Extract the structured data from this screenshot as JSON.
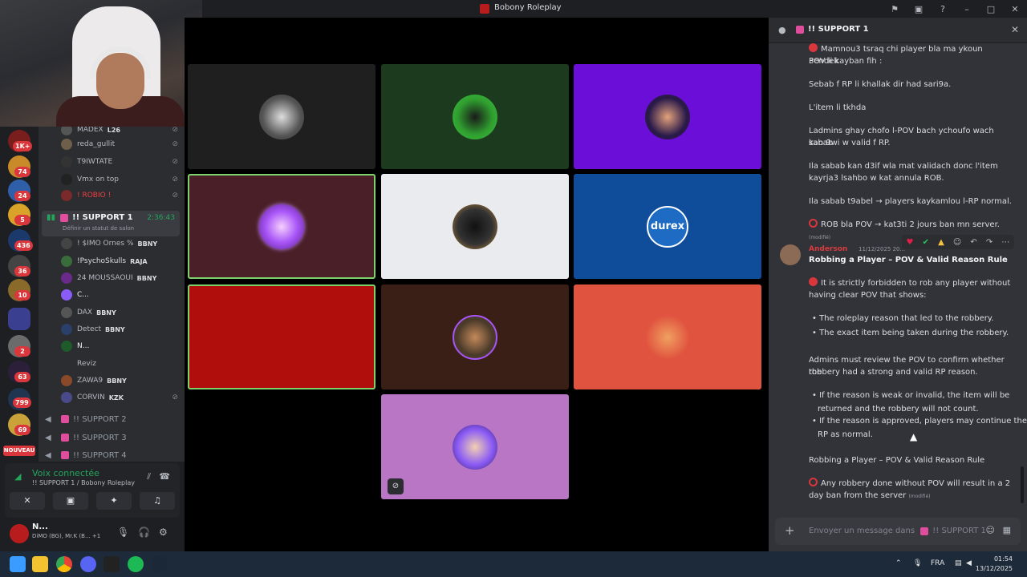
{
  "window": {
    "title": "Bobony Roleplay"
  },
  "rail": {
    "badges": [
      "1K+",
      "74",
      "24",
      "5",
      "436",
      "36",
      "10",
      "2",
      "63",
      "799",
      "69"
    ],
    "nouveau_label": "NOUVEAU"
  },
  "sidebar": {
    "members_top": [
      {
        "name": "MADEX",
        "tag": "L26"
      },
      {
        "name": "reda_gullit",
        "tag": ""
      },
      {
        "name": "T9IWTATE",
        "tag": ""
      },
      {
        "name": "Vmx on top",
        "tag": ""
      },
      {
        "name": "! ROBIO !",
        "tag": ""
      }
    ],
    "support1": {
      "label": "!! SUPPORT 1",
      "time": "2:36:43",
      "status": "Définir un statut de salon"
    },
    "members": [
      {
        "name": "! $IMO Ornes %",
        "tag": "BBNY"
      },
      {
        "name": "!PsychoSkulls",
        "tag": "RAJA"
      },
      {
        "name": "24 MOUSSAOUI",
        "tag": "BBNY"
      },
      {
        "name": "C...",
        "tag": ""
      },
      {
        "name": "DAX",
        "tag": "BBNY"
      },
      {
        "name": "Detect",
        "tag": "BBNY"
      },
      {
        "name": "N...",
        "tag": ""
      },
      {
        "name": "Reviz",
        "tag": ""
      },
      {
        "name": "ZAWA9",
        "tag": "BBNY"
      },
      {
        "name": "CORVIN",
        "tag": "KZK"
      }
    ],
    "channels": [
      "!! SUPPORT 2",
      "!! SUPPORT 3",
      "!! SUPPORT 4"
    ]
  },
  "voice": {
    "title": "Voix connectée",
    "subtitle": "!! SUPPORT 1 / Bobony Roleplay"
  },
  "user": {
    "name": "N...",
    "status": "DiMO (BG), Mr.K (B...  +1"
  },
  "stage": {
    "tiles": [
      {
        "bg": "#1f1f1f",
        "avatar": "#444444",
        "speaking": false
      },
      {
        "bg": "#1b3a1e",
        "avatar": "#3fbf3f",
        "speaking": false
      },
      {
        "bg": "#6a0ed8",
        "avatar": "#2a1a4a",
        "speaking": false
      },
      {
        "bg": "#4a1f27",
        "avatar": "#a855f7",
        "speaking": true
      },
      {
        "bg": "#e9ebee",
        "avatar": "#222222",
        "speaking": false
      },
      {
        "bg": "#0f4c9a",
        "avatar": "#1e6bc4",
        "speaking": false
      },
      {
        "bg": "#b00d0d",
        "avatar": "#b00d0d",
        "speaking": true
      },
      {
        "bg": "#3a1f16",
        "avatar": "#4a3a2a",
        "speaking": false
      },
      {
        "bg": "#e0533f",
        "avatar": "#e0533f",
        "speaking": false
      },
      {
        "bg": "#b876c4",
        "avatar": "#8b5cf6",
        "speaking": false
      }
    ],
    "durex_label": "durex"
  },
  "chat": {
    "header": "!! SUPPORT 1",
    "msg1": {
      "l1": "Mamnou3 tsraq chi player bla ma ykoun 3endek",
      "l2": "POV li kayban fih :",
      "l3": "Sebab f RP li khallak dir had sari9a.",
      "l4": "L'item li tkhda",
      "l5": " Ladmins ghay chofo l-POV bach ychoufo wach sabab",
      "l6": "kan 9wi w valid f RP.",
      "l7": "Ila sabab kan d3if wla mat validach donc l'item",
      "l8": "kayrja3 lsahbo w kat annula ROB.",
      "l9": "Ila sabab t9abel → players kaykamlou l-RP normal.",
      "l10": "ROB bla POV → kat3ti 2 jours ban mn server.",
      "edited": "(modifié)"
    },
    "msg2": {
      "author": "Anderson",
      "time": "11/12/2025 20...",
      "title": "Robbing a Player – POV & Valid Reason Rule",
      "p1a": "It is strictly forbidden to rob any player without",
      "p1b": "having clear POV that shows:",
      "b1": "The roleplay reason that led to the robbery.",
      "b2": "The exact item being taken during the robbery.",
      "p2a": "Admins must review the POV to confirm whether the",
      "p2b": "robbery had a strong and valid RP reason.",
      "b3a": "If the reason is weak or invalid, the item will be",
      "b3b": "returned and the robbery will not count.",
      "b4a": "If the reason is approved, players may continue the",
      "b4b": "RP as normal.",
      "p3": "Robbing a Player – POV & Valid Reason Rule",
      "p4a": "Any robbery done without POV will result in a 2",
      "p4b": "day ban from the server",
      "edited": "(modifié)"
    },
    "input_placeholder": "Envoyer un message dans",
    "input_channel": "!! SUPPORT 1"
  },
  "taskbar": {
    "lang": "FRA",
    "time": "01:54",
    "date": "13/12/2025"
  }
}
